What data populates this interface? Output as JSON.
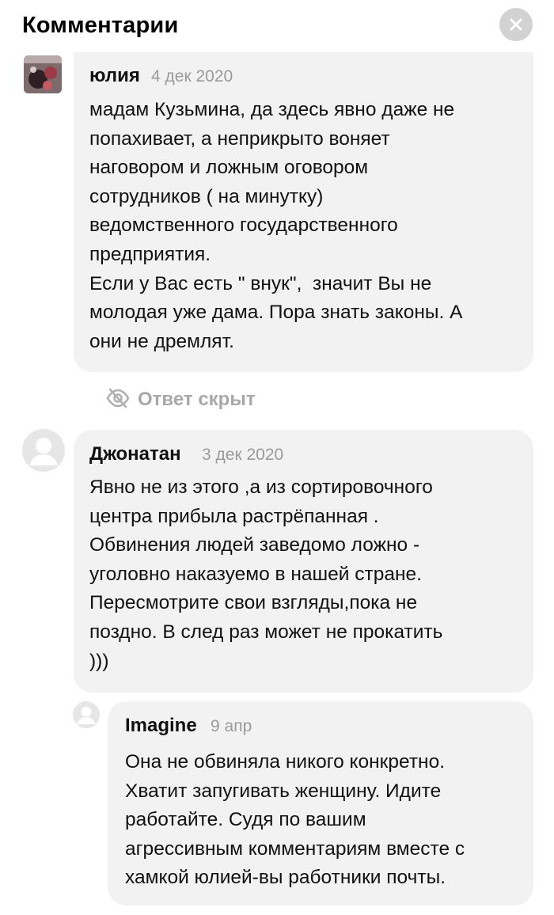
{
  "header": {
    "title": "Комментарии",
    "close_icon": "close-icon"
  },
  "comments": [
    {
      "author": "юлия",
      "date": "4 дек 2020",
      "text": "мадам Кузьмина, да здесь явно даже не\nпопахивает, а неприкрыто воняет\nнаговором и ложным оговором\nсотрудников ( на минутку)\nведомственного государственного\nпредприятия.\nЕсли у Вас есть \" внук\",  значит Вы не\nмолодая уже дама. Пора знать законы. А\nони не дремлят.",
      "avatar": "user-photo"
    },
    {
      "author": "Джонатан",
      "date": "3 дек 2020",
      "text": "Явно не из этого ,а из сортировочного\nцентра прибыла растрёпанная .\nОбвинения людей заведомо ложно -\nуголовно наказуемо в нашей стране.\nПересмотрите свои взгляды,пока не\nпоздно. В след раз может не прокатить\n)))",
      "avatar": "default-user-avatar"
    }
  ],
  "hidden_reply": {
    "label": "Ответ скрыт",
    "icon": "eye-slash-icon"
  },
  "reply": {
    "author": "Imagine",
    "date": "9 апр",
    "text": "Она не обвиняла никого конкретно.\nХватит запугивать женщину. Идите\nработайте. Судя по вашим\nагрессивным комментариям вместе с\nхамкой юлией-вы работники почты.",
    "avatar": "default-user-avatar"
  },
  "colors": {
    "bubble": "#f2f2f2",
    "date": "#9a9a9a",
    "hidden": "#a8a8a8",
    "close_bg": "#d2d2d2"
  }
}
